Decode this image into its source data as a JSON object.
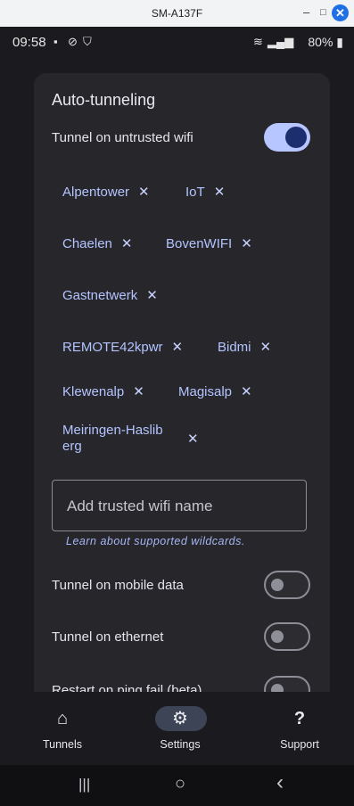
{
  "window": {
    "title": "SM-A137F",
    "minimize": "–",
    "maximize": "□",
    "close": "✕"
  },
  "status_bar": {
    "time": "09:58",
    "battery": "80%",
    "icons": [
      "sim-icon",
      "sync-icon",
      "shield-icon",
      "wifi-icon",
      "signal-icon",
      "battery-icon"
    ]
  },
  "auto_tunneling": {
    "title": "Auto-tunneling",
    "untrusted_wifi": {
      "label": "Tunnel on untrusted wifi",
      "enabled": true
    },
    "trusted_networks": [
      "Alpentower",
      "IoT",
      "Chaelen",
      "BovenWIFI",
      "Gastnetwerk",
      "REMOTE42kpwr",
      "Bidmi",
      "Klewenalp",
      "Magisalp",
      "Meiringen-Haslib",
      "erg"
    ],
    "remove_symbol": "✕",
    "add_input": {
      "placeholder": "Add trusted wifi name",
      "value": ""
    },
    "wildcards_link": "Learn about supported wildcards.",
    "mobile_data": {
      "label": "Tunnel on mobile data",
      "enabled": false
    },
    "ethernet": {
      "label": "Tunnel on ethernet",
      "enabled": false
    },
    "ping_restart": {
      "label": "Restart on ping fail (beta)",
      "enabled": false
    }
  },
  "bottom_nav": {
    "items": [
      {
        "label": "Tunnels",
        "icon": "home-icon",
        "glyph": "⌂",
        "active": false
      },
      {
        "label": "Settings",
        "icon": "gear-icon",
        "glyph": "⚙",
        "active": true
      },
      {
        "label": "Support",
        "icon": "help-icon",
        "glyph": "?",
        "active": false
      }
    ]
  },
  "system_nav": {
    "recents": "|||",
    "home": "○",
    "back": "‹"
  },
  "colors": {
    "accent": "#b8c6ff",
    "accent_dark": "#1c2e6e",
    "card": "#26262b",
    "background": "#1b1b1f"
  }
}
